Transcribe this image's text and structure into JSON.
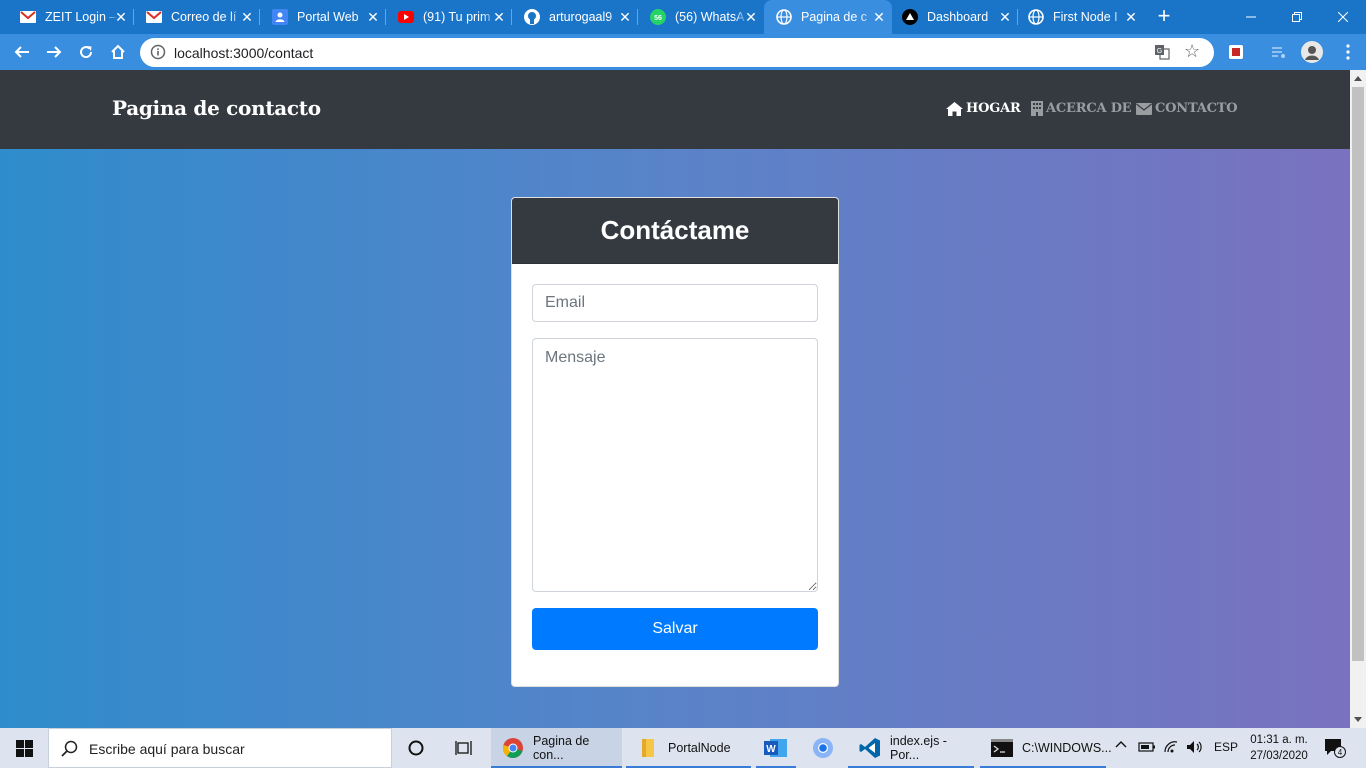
{
  "browser": {
    "tabs": [
      {
        "title": "ZEIT Login – ZE",
        "icon": "gmail-icon"
      },
      {
        "title": "Correo de lí",
        "icon": "gmail-icon"
      },
      {
        "title": "Portal Web",
        "icon": "contacts-icon"
      },
      {
        "title": "(91) Tu prim",
        "icon": "youtube-icon"
      },
      {
        "title": "arturogaal9",
        "icon": "github-icon"
      },
      {
        "title": "(56) WhatsA",
        "icon": "whatsapp-icon",
        "badge": "56"
      },
      {
        "title": "Pagina de c",
        "icon": "globe-icon",
        "active": true
      },
      {
        "title": "Dashboard",
        "icon": "vercel-icon"
      },
      {
        "title": "First Node I",
        "icon": "globe-icon"
      }
    ],
    "url": "localhost:3000/contact"
  },
  "navbar": {
    "brand": "Pagina de contacto",
    "links": [
      {
        "label": "HOGAR",
        "icon": "home-icon",
        "active": true
      },
      {
        "label": "ACERCA DE",
        "icon": "building-icon",
        "active": false
      },
      {
        "label": "CONTACTO",
        "icon": "envelope-icon",
        "active": false
      }
    ]
  },
  "contact_form": {
    "title": "Contáctame",
    "email_placeholder": "Email",
    "message_placeholder": "Mensaje",
    "submit_label": "Salvar"
  },
  "taskbar": {
    "search_placeholder": "Escribe aquí para buscar",
    "apps": [
      {
        "label": "Pagina de con...",
        "icon": "chrome-icon"
      },
      {
        "label": "PortalNode",
        "icon": "folder-icon"
      },
      {
        "label": "",
        "icon": "word-icon"
      },
      {
        "label": "",
        "icon": "chromium-icon"
      },
      {
        "label": "index.ejs - Por...",
        "icon": "vscode-icon"
      },
      {
        "label": "C:\\WINDOWS...",
        "icon": "cmd-icon"
      }
    ],
    "language": "ESP",
    "time": "01:31 a. m.",
    "date": "27/03/2020",
    "notification_count": "4"
  },
  "colors": {
    "navbar": "#343a40",
    "primary": "#007bff",
    "gradient_start": "#2f8ccc",
    "gradient_end": "#7a72bf"
  }
}
